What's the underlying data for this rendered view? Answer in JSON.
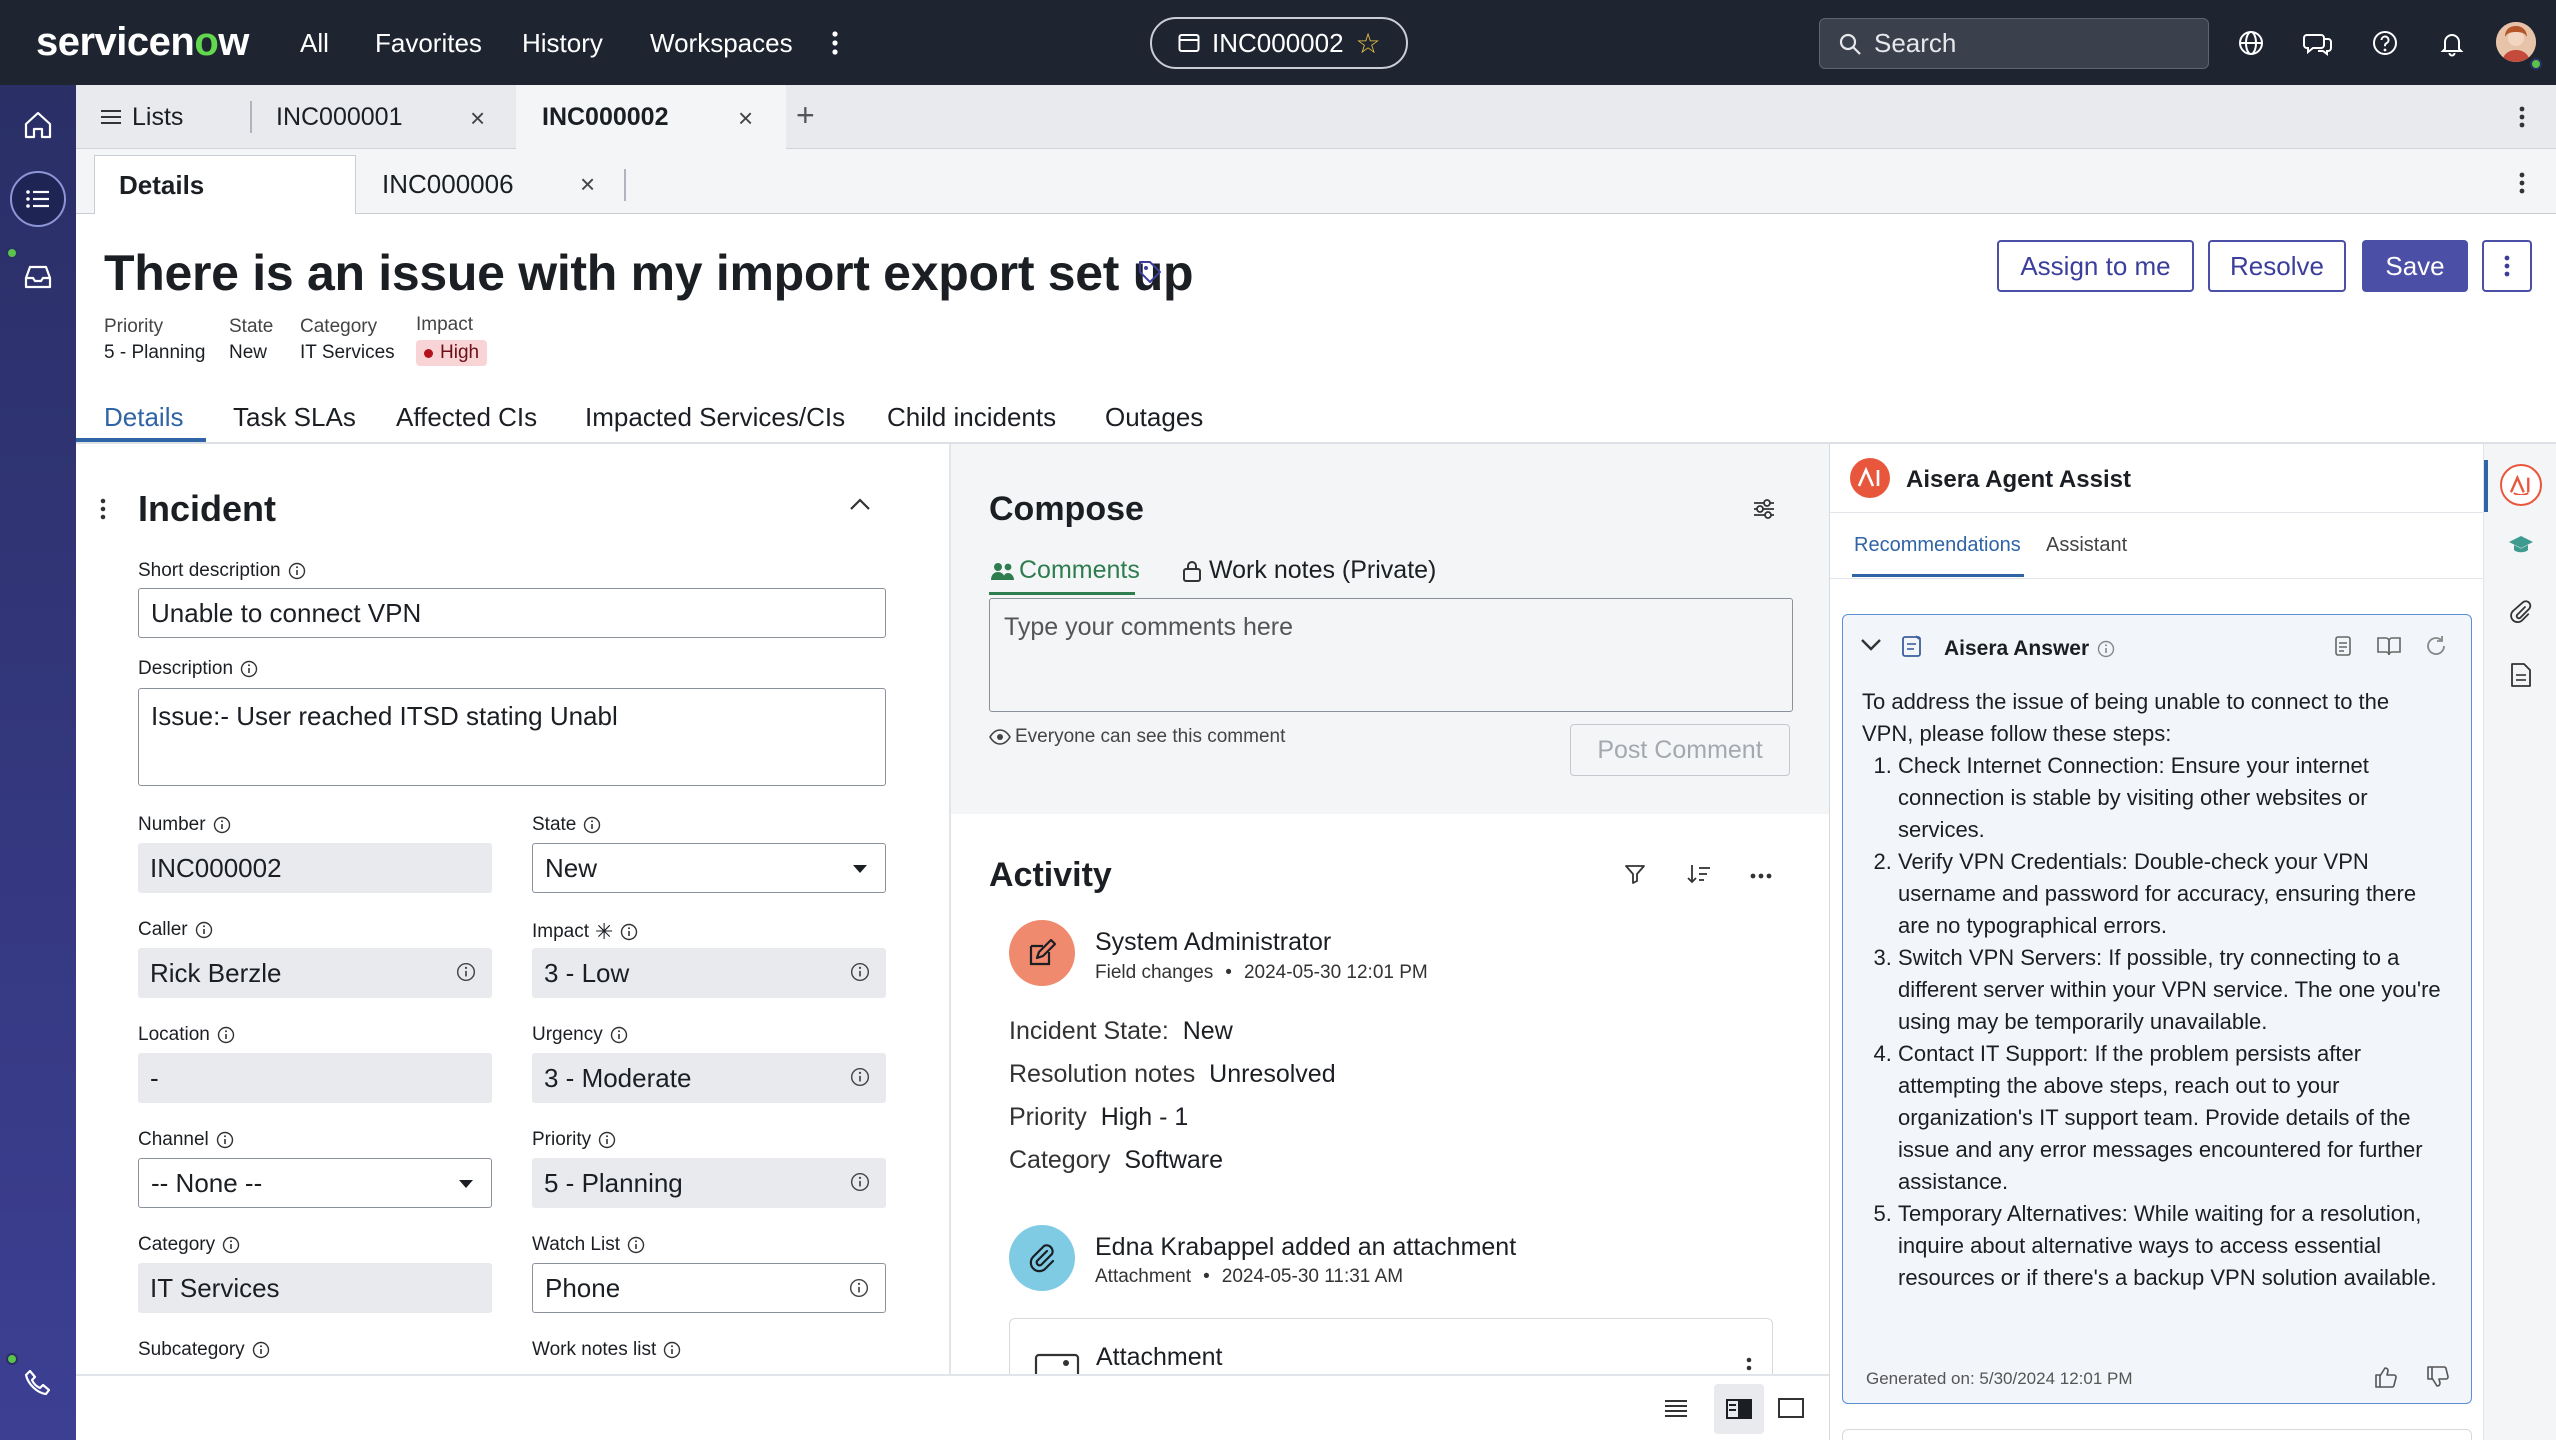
{
  "nav": {
    "logo_pre": "servicen",
    "logo_o": "o",
    "logo_post": "w",
    "links": [
      "All",
      "Favorites",
      "History",
      "Workspaces"
    ],
    "record_pill": "INC000002",
    "search_placeholder": "Search"
  },
  "tabs1": {
    "lists_label": "Lists",
    "items": [
      "INC000001",
      "INC000002"
    ]
  },
  "tabs2": {
    "items": [
      "Details",
      "INC000006"
    ]
  },
  "header": {
    "title": "There is an issue with my import export set up",
    "meta": [
      {
        "label": "Priority",
        "value": "5 - Planning"
      },
      {
        "label": "State",
        "value": "New"
      },
      {
        "label": "Category",
        "value": "IT Services"
      },
      {
        "label": "Impact",
        "value": "High"
      }
    ],
    "buttons": {
      "assign": "Assign to me",
      "resolve": "Resolve",
      "save": "Save"
    },
    "form_tabs": [
      "Details",
      "Task SLAs",
      "Affected CIs",
      "Impacted Services/CIs",
      "Child incidents",
      "Outages"
    ]
  },
  "form": {
    "section_title": "Incident",
    "short_desc_label": "Short description",
    "short_desc_value": "Unable to connect VPN",
    "desc_label": "Description",
    "desc_value": "Issue:- User reached ITSD stating Unabl",
    "number_label": "Number",
    "number_value": "INC000002",
    "state_label": "State",
    "state_value": "New",
    "caller_label": "Caller",
    "caller_value": "Rick Berzle",
    "impact_label": "Impact",
    "impact_value": "3 - Low",
    "location_label": "Location",
    "location_value": "-",
    "urgency_label": "Urgency",
    "urgency_value": "3 - Moderate",
    "channel_label": "Channel",
    "channel_value": "-- None --",
    "priority_label": "Priority",
    "priority_value": "5 - Planning",
    "category_label": "Category",
    "category_value": "IT Services",
    "watch_label": "Watch List",
    "watch_value": "Phone",
    "subcategory_label": "Subcategory",
    "worknotes_label": "Work notes list"
  },
  "compose": {
    "title": "Compose",
    "tab_comments": "Comments",
    "tab_worknotes": "Work notes (Private)",
    "placeholder": "Type your comments here",
    "visibility": "Everyone can see this comment",
    "post_button": "Post Comment"
  },
  "activity": {
    "title": "Activity",
    "entry1": {
      "author": "System Administrator",
      "type": "Field changes",
      "time": "2024-05-30 12:01 PM",
      "fields": [
        {
          "k": "Incident State:",
          "v": "New"
        },
        {
          "k": "Resolution notes",
          "v": "Unresolved"
        },
        {
          "k": "Priority",
          "v": "High - 1"
        },
        {
          "k": "Category",
          "v": "Software"
        }
      ]
    },
    "entry2": {
      "author": "Edna Krabappel added an attachment",
      "type": "Attachment",
      "time": "2024-05-30 11:31 AM",
      "card_title": "Attachment"
    }
  },
  "aisera": {
    "title": "Aisera Agent Assist",
    "tab_recommendations": "Recommendations",
    "tab_assistant": "Assistant",
    "answer_title": "Aisera Answer",
    "intro": "To address the issue of being unable to connect to the VPN, please follow these steps:",
    "steps": [
      "Check Internet Connection: Ensure your internet connection is stable by visiting other websites or services.",
      "Verify VPN Credentials: Double-check your VPN username and password for accuracy, ensuring there are no typographical errors.",
      "Switch VPN Servers: If possible, try connecting to a different server within your VPN service. The one you're using may be temporarily unavailable.",
      "Contact IT Support: If the problem persists after attempting the above steps, reach out to your organization's IT support team. Provide details of the issue and any error messages encountered for further assistance.",
      "Temporary Alternatives: While waiting for a resolution, inquire about alternative ways to access essential resources or if there's a backup VPN solution available."
    ],
    "generated": "Generated on: 5/30/2024 12:01 PM"
  },
  "colors": {
    "accent": "#4b4fa6",
    "nav_bg": "#1e2430",
    "link_blue": "#2f64a6",
    "comments_green": "#2e7d4f",
    "aisera_red": "#e8573c"
  }
}
